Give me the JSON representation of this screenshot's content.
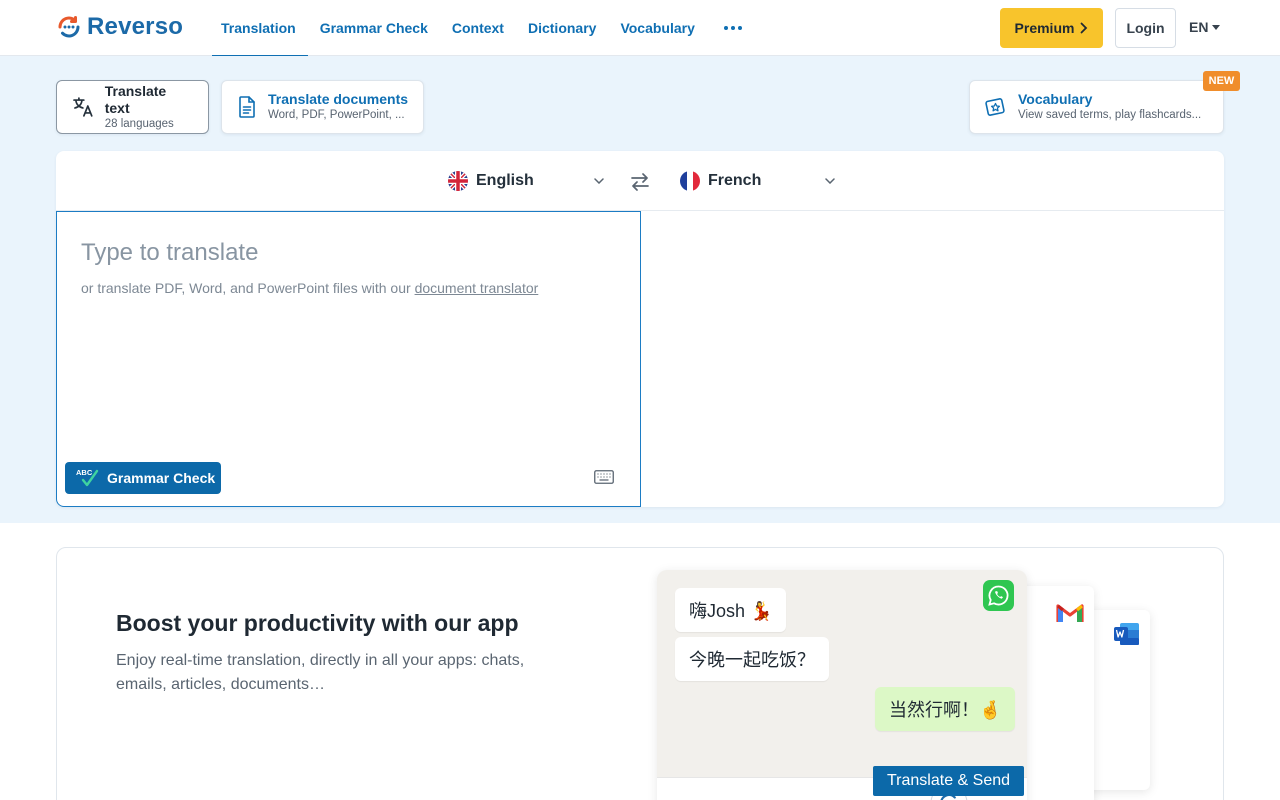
{
  "brand": {
    "name": "Reverso"
  },
  "nav": {
    "items": [
      "Translation",
      "Grammar Check",
      "Context",
      "Dictionary",
      "Vocabulary"
    ],
    "active_index": 0,
    "more_icon": "more-horizontal-icon"
  },
  "header": {
    "premium_label": "Premium",
    "login_label": "Login",
    "ui_language": "EN"
  },
  "mode_tabs": {
    "text": {
      "title": "Translate text",
      "subtitle": "28 languages"
    },
    "documents": {
      "title": "Translate documents",
      "subtitle": "Word, PDF, PowerPoint, ..."
    },
    "vocabulary": {
      "title": "Vocabulary",
      "subtitle": "View saved terms, play flashcards...",
      "badge": "NEW"
    }
  },
  "translator": {
    "source_language": "English",
    "target_language": "French",
    "placeholder": "Type to translate",
    "hint_prefix": "or translate PDF, Word, and PowerPoint files with our ",
    "hint_link": "document translator",
    "grammar_check_label": "Grammar Check"
  },
  "promo": {
    "title": "Boost your productivity with our app",
    "text": "Enjoy real-time translation, directly in all your apps: chats, emails, articles, documents…",
    "chat": {
      "msg1": "嗨Josh 💃",
      "msg2": "今晚一起吃饭？",
      "msg3": "当然行啊！🤞",
      "action": "Translate & Send"
    }
  },
  "colors": {
    "brand_blue": "#0f6fb3",
    "premium_yellow": "#f8c42c",
    "badge_orange": "#f08d2b",
    "hero_bg": "#eaf4fc"
  }
}
